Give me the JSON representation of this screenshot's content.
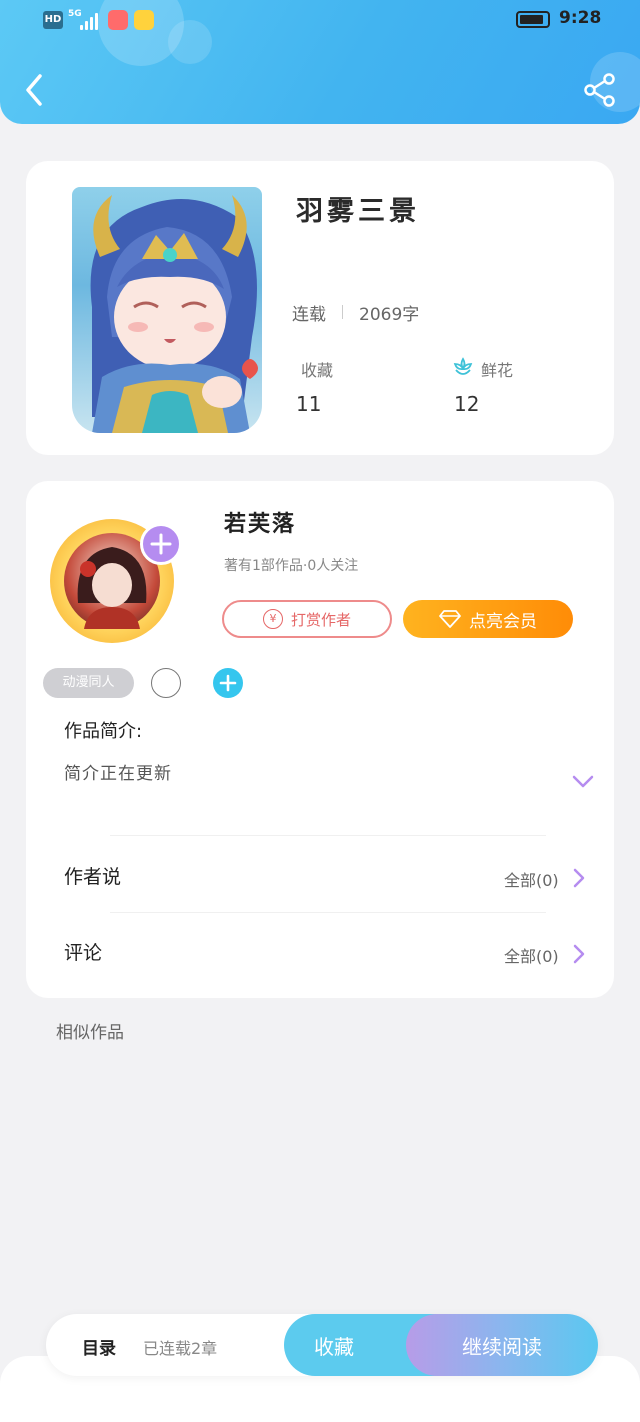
{
  "status_bar": {
    "network_hd": "HD",
    "network_5g": "5G",
    "time": "9:28"
  },
  "book": {
    "title": "羽雾三景",
    "status": "连载",
    "word_count": "2069字",
    "favorites_label": "收藏",
    "favorites_count": "11",
    "flowers_label": "鲜花",
    "flowers_count": "12"
  },
  "author": {
    "name": "若芙落",
    "stats": "著有1部作品·0人关注",
    "tip_icon": "¥",
    "tip_label": "打赏作者",
    "vip_label": "点亮会员"
  },
  "tags": [
    "动漫同人"
  ],
  "intro": {
    "title": "作品简介:",
    "text": "简介正在更新"
  },
  "rows": {
    "author_says": {
      "label": "作者说",
      "right": "全部(0)"
    },
    "comments": {
      "label": "评论",
      "right": "全部(0)"
    }
  },
  "similar": {
    "title": "相似作品"
  },
  "bottom_bar": {
    "toc_label": "目录",
    "toc_status": "已连载2章",
    "favorite_label": "收藏",
    "continue_label": "继续阅读"
  },
  "colors": {
    "header_blue": "#42b4f0",
    "vip_orange": "#ff8c07",
    "tip_red": "#e56767",
    "accent_purple": "#b58cf0",
    "tag_add_cyan": "#35c6ee"
  }
}
